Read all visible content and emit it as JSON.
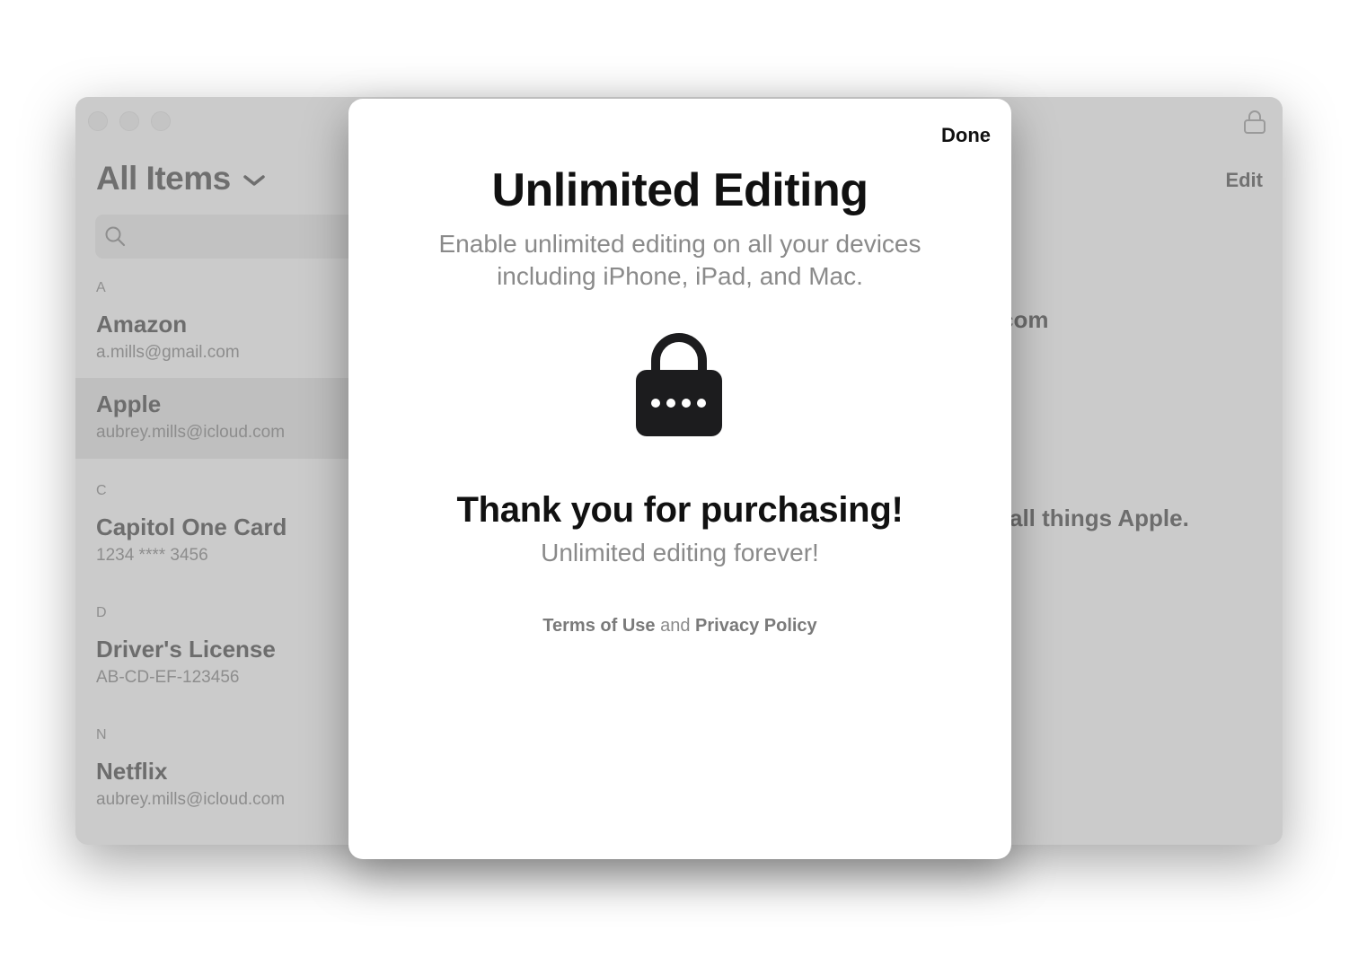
{
  "window": {
    "title": "All Items",
    "search": {
      "placeholder": ""
    },
    "sections": [
      {
        "letter": "A",
        "items": [
          {
            "name": "Amazon",
            "sub": "a.mills@gmail.com",
            "selected": false
          },
          {
            "name": "Apple",
            "sub": "aubrey.mills@icloud.com",
            "selected": true
          }
        ]
      },
      {
        "letter": "C",
        "items": [
          {
            "name": "Capitol One Card",
            "sub": "1234 **** 3456",
            "selected": false
          }
        ]
      },
      {
        "letter": "D",
        "items": [
          {
            "name": "Driver's License",
            "sub": "AB-CD-EF-123456",
            "selected": false
          }
        ]
      },
      {
        "letter": "N",
        "items": [
          {
            "name": "Netflix",
            "sub": "aubrey.mills@icloud.com",
            "selected": false
          }
        ]
      }
    ],
    "detail": {
      "edit_label": "Edit",
      "fragment_1": "com",
      "fragment_2": "all things Apple."
    }
  },
  "modal": {
    "done_label": "Done",
    "title": "Unlimited Editing",
    "description_line1": "Enable unlimited editing on all your devices",
    "description_line2": "including iPhone, iPad, and Mac.",
    "icon": "lock-icon",
    "thanks": "Thank you for purchasing!",
    "subtitle": "Unlimited editing forever!",
    "terms_label": "Terms of Use",
    "and_label": "and",
    "privacy_label": "Privacy Policy"
  }
}
